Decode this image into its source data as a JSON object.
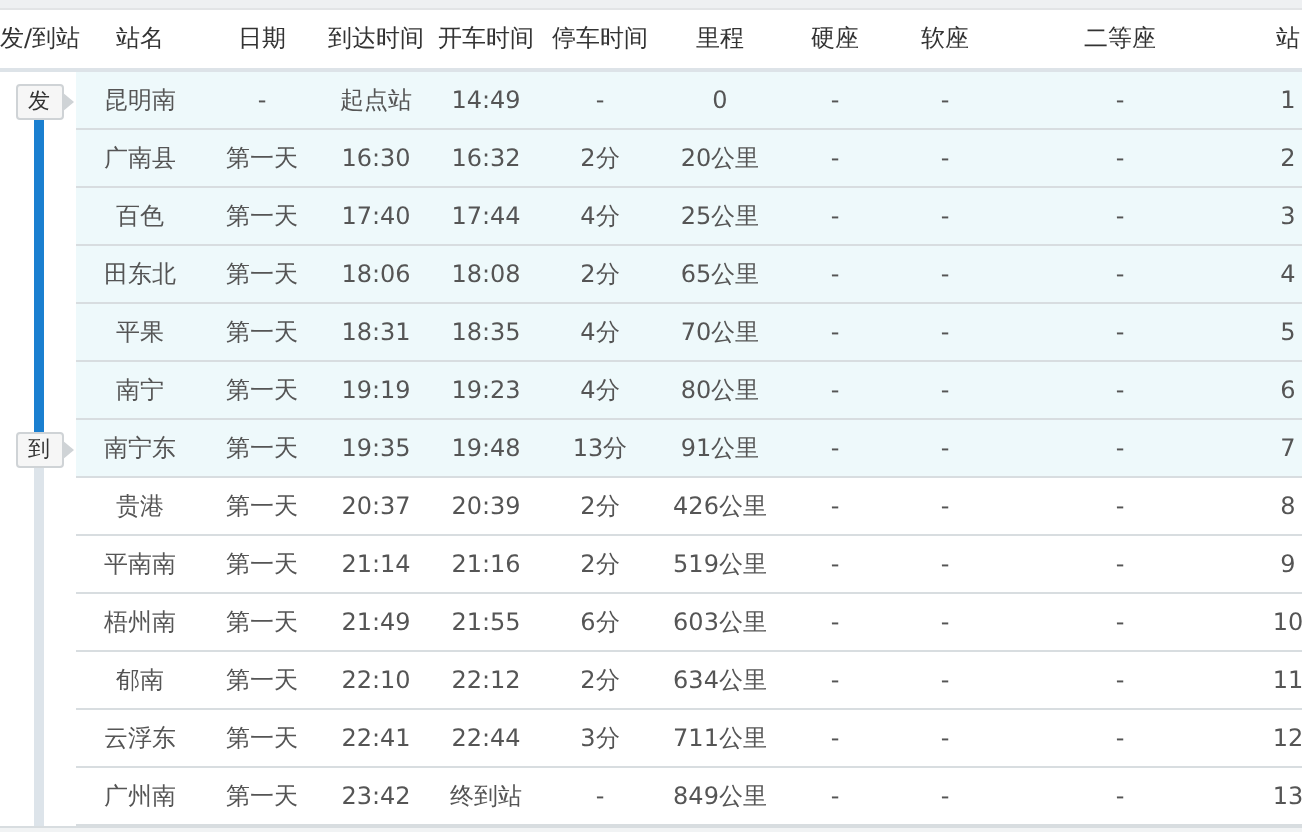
{
  "columns": [
    "发/到站",
    "站名",
    "日期",
    "到达时间",
    "开车时间",
    "停车时间",
    "里程",
    "硬座",
    "软座",
    "二等座",
    "站"
  ],
  "rows": [
    {
      "tag": "发",
      "in_route": true,
      "cells": [
        "昆明南",
        "-",
        "起点站",
        "14:49",
        "-",
        "0",
        "-",
        "-",
        "-",
        "1"
      ]
    },
    {
      "in_route": true,
      "cells": [
        "广南县",
        "第一天",
        "16:30",
        "16:32",
        "2分",
        "20公里",
        "-",
        "-",
        "-",
        "2"
      ]
    },
    {
      "in_route": true,
      "cells": [
        "百色",
        "第一天",
        "17:40",
        "17:44",
        "4分",
        "25公里",
        "-",
        "-",
        "-",
        "3"
      ]
    },
    {
      "in_route": true,
      "cells": [
        "田东北",
        "第一天",
        "18:06",
        "18:08",
        "2分",
        "65公里",
        "-",
        "-",
        "-",
        "4"
      ]
    },
    {
      "in_route": true,
      "cells": [
        "平果",
        "第一天",
        "18:31",
        "18:35",
        "4分",
        "70公里",
        "-",
        "-",
        "-",
        "5"
      ]
    },
    {
      "in_route": true,
      "cells": [
        "南宁",
        "第一天",
        "19:19",
        "19:23",
        "4分",
        "80公里",
        "-",
        "-",
        "-",
        "6"
      ]
    },
    {
      "tag": "到",
      "in_route": true,
      "cells": [
        "南宁东",
        "第一天",
        "19:35",
        "19:48",
        "13分",
        "91公里",
        "-",
        "-",
        "-",
        "7"
      ]
    },
    {
      "in_route": false,
      "cells": [
        "贵港",
        "第一天",
        "20:37",
        "20:39",
        "2分",
        "426公里",
        "-",
        "-",
        "-",
        "8"
      ]
    },
    {
      "in_route": false,
      "cells": [
        "平南南",
        "第一天",
        "21:14",
        "21:16",
        "2分",
        "519公里",
        "-",
        "-",
        "-",
        "9"
      ]
    },
    {
      "in_route": false,
      "cells": [
        "梧州南",
        "第一天",
        "21:49",
        "21:55",
        "6分",
        "603公里",
        "-",
        "-",
        "-",
        "10"
      ]
    },
    {
      "in_route": false,
      "cells": [
        "郁南",
        "第一天",
        "22:10",
        "22:12",
        "2分",
        "634公里",
        "-",
        "-",
        "-",
        "11"
      ]
    },
    {
      "in_route": false,
      "cells": [
        "云浮东",
        "第一天",
        "22:41",
        "22:44",
        "3分",
        "711公里",
        "-",
        "-",
        "-",
        "12"
      ]
    },
    {
      "in_route": false,
      "cells": [
        "广州南",
        "第一天",
        "23:42",
        "终到站",
        "-",
        "849公里",
        "-",
        "-",
        "-",
        "13"
      ]
    }
  ]
}
